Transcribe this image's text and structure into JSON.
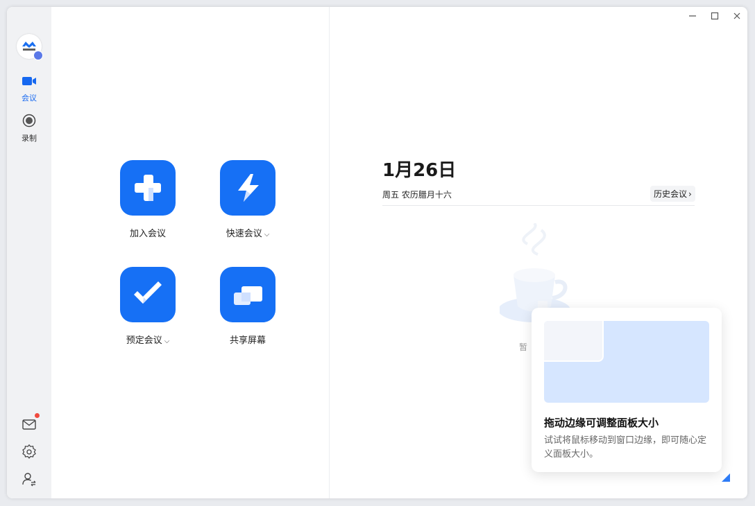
{
  "app": {
    "logo_text": "腾讯会议"
  },
  "sidebar": {
    "items": [
      {
        "label": "会议",
        "icon": "video-camera-icon",
        "active": true
      },
      {
        "label": "录制",
        "icon": "record-icon",
        "active": false
      }
    ],
    "bottom": [
      {
        "icon": "mail-icon",
        "badge": true
      },
      {
        "icon": "gear-icon"
      },
      {
        "icon": "user-switch-icon"
      }
    ]
  },
  "actions": [
    {
      "label": "加入会议",
      "icon": "plus-icon",
      "dropdown": false
    },
    {
      "label": "快速会议",
      "icon": "lightning-icon",
      "dropdown": true
    },
    {
      "label": "预定会议",
      "icon": "check-icon",
      "dropdown": true
    },
    {
      "label": "共享屏幕",
      "icon": "share-screen-icon",
      "dropdown": false
    }
  ],
  "schedule": {
    "date": "1月26日",
    "subtitle": "周五 农历腊月十六",
    "history_label": "历史会议",
    "empty_text": "暂"
  },
  "popup": {
    "title": "拖动边缘可调整面板大小",
    "body": "试试将鼠标移动到窗口边缘，即可随心定义面板大小。"
  },
  "colors": {
    "accent": "#1670f5",
    "sidebar_bg": "#f1f2f4",
    "badge_red": "#f04a3e"
  }
}
